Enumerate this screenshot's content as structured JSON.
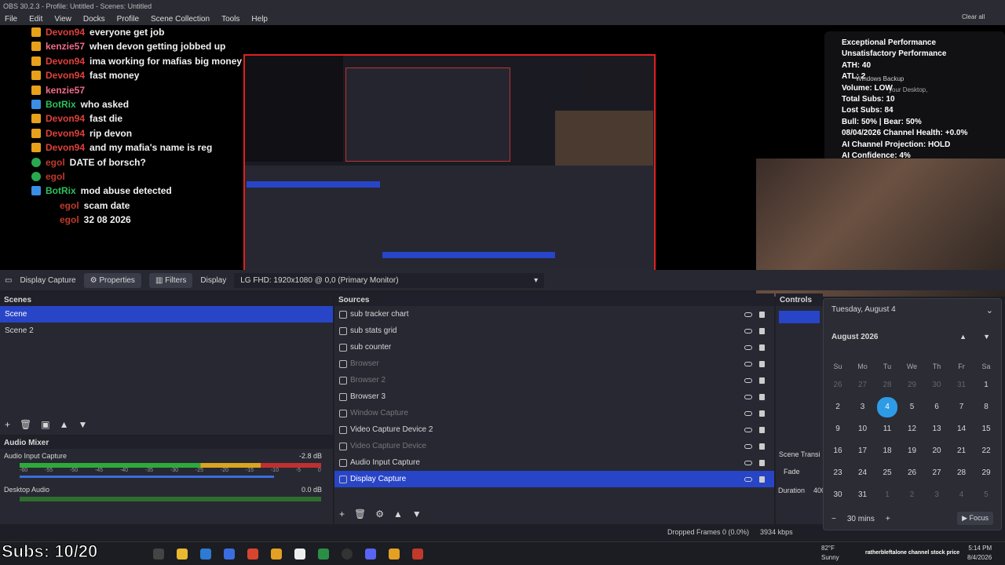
{
  "window": {
    "title": "OBS 30.2.3 - Profile: Untitled - Scenes: Untitled"
  },
  "menu": [
    "File",
    "Edit",
    "View",
    "Docks",
    "Profile",
    "Scene Collection",
    "Tools",
    "Help"
  ],
  "chat": [
    {
      "user": "Devon94",
      "msg": "everyone get job",
      "type": "crown",
      "ucls": "user-devon"
    },
    {
      "user": "kenzie57",
      "msg": "when devon getting jobbed up",
      "type": "crown",
      "ucls": "user-kenzie"
    },
    {
      "user": "Devon94",
      "msg": "ima working for mafias big money",
      "type": "crown",
      "ucls": "user-devon"
    },
    {
      "user": "Devon94",
      "msg": "fast money",
      "type": "crown",
      "ucls": "user-devon"
    },
    {
      "user": "kenzie57",
      "msg": "",
      "type": "crown",
      "ucls": "user-kenzie"
    },
    {
      "user": "BotRix",
      "msg": "who asked",
      "type": "bot",
      "ucls": "user-bot"
    },
    {
      "user": "Devon94",
      "msg": "fast die",
      "type": "crown",
      "ucls": "user-devon"
    },
    {
      "user": "Devon94",
      "msg": "rip devon",
      "type": "crown",
      "ucls": "user-devon"
    },
    {
      "user": "Devon94",
      "msg": "and my mafia's name is reg",
      "type": "crown",
      "ucls": "user-devon"
    },
    {
      "user": "egol",
      "msg": "DATE of borsch?",
      "type": "mod",
      "ucls": "user-egol"
    },
    {
      "user": "egol",
      "msg": "",
      "type": "mod",
      "ucls": "user-egol"
    },
    {
      "user": "BotRix",
      "msg": "mod abuse detected",
      "type": "bot",
      "ucls": "user-bot"
    },
    {
      "user": "egol",
      "msg": "scam date",
      "type": "none",
      "ucls": "user-egol"
    },
    {
      "user": "egol",
      "msg": "32 08 2026",
      "type": "none",
      "ucls": "user-egol"
    }
  ],
  "stats": [
    {
      "text": "Exceptional Performance",
      "color": "#ffffff"
    },
    {
      "text": "Unsatisfactory Performance",
      "color": "#ffffff"
    },
    {
      "text": "ATH: 40",
      "color": "#ffffff"
    },
    {
      "text": "ATL: 2",
      "color": "#ffffff"
    },
    {
      "text": "Volume: LOW",
      "color": "#ffffff"
    },
    {
      "text": "Total Subs: 10",
      "color": "#ffffff"
    },
    {
      "text": "Lost Subs: 84",
      "color": "#ffffff"
    },
    {
      "text": "Bull: 50% | Bear: 50%",
      "color": "#ffffff"
    },
    {
      "text": "08/04/2026 Channel Health: +0.0%",
      "color": "#ffffff"
    },
    {
      "text": "AI Channel Projection: HOLD",
      "color": "#ffffff"
    },
    {
      "text": "AI Confidence: 4%",
      "color": "#ffffff"
    }
  ],
  "notif": {
    "title": "Windows Backup",
    "sub": "your Desktop,",
    "clear": "Clear all"
  },
  "source_toolbar": {
    "name": "Display Capture",
    "properties": "Properties",
    "filters": "Filters",
    "display_label": "Display",
    "display_value": "LG FHD: 1920x1080 @ 0,0 (Primary Monitor)"
  },
  "scenes": {
    "title": "Scenes",
    "items": [
      "Scene",
      "Scene 2"
    ]
  },
  "sources": {
    "title": "Sources",
    "items": [
      {
        "name": "sub tracker chart",
        "dim": false
      },
      {
        "name": "sub stats grid",
        "dim": false
      },
      {
        "name": "sub counter",
        "dim": false
      },
      {
        "name": "Browser",
        "dim": true
      },
      {
        "name": "Browser 2",
        "dim": true
      },
      {
        "name": "Browser 3",
        "dim": false
      },
      {
        "name": "Window Capture",
        "dim": true
      },
      {
        "name": "Video Capture Device 2",
        "dim": false
      },
      {
        "name": "Video Capture Device",
        "dim": true
      },
      {
        "name": "Audio Input Capture",
        "dim": false
      },
      {
        "name": "Display Capture",
        "dim": false
      }
    ]
  },
  "mixer": {
    "title": "Audio Mixer",
    "ch1": "Audio Input Capture",
    "ch1db": "-2.8 dB",
    "ch2": "Desktop Audio",
    "ch2db": "0.0 dB",
    "ticks": [
      "-60",
      "-55",
      "-50",
      "-45",
      "-40",
      "-35",
      "-30",
      "-25",
      "-20",
      "-15",
      "-10",
      "-5",
      "0"
    ]
  },
  "controls": {
    "title": "Controls",
    "transition": "Scene Transi",
    "fade": "Fade",
    "duration": "Duration",
    "dur_val": "400"
  },
  "calendar": {
    "header": "Tuesday, August 4",
    "month": "August 2026",
    "days": [
      "Su",
      "Mo",
      "Tu",
      "We",
      "Th",
      "Fr",
      "Sa"
    ],
    "cells": [
      "26",
      "27",
      "28",
      "29",
      "30",
      "31",
      "1",
      "2",
      "3",
      "4",
      "5",
      "6",
      "7",
      "8",
      "9",
      "10",
      "11",
      "12",
      "13",
      "14",
      "15",
      "16",
      "17",
      "18",
      "19",
      "20",
      "21",
      "22",
      "23",
      "24",
      "25",
      "26",
      "27",
      "28",
      "29",
      "30",
      "31",
      "1",
      "2",
      "3",
      "4",
      "5"
    ],
    "focus_time": "30 mins",
    "focus": "Focus"
  },
  "status": {
    "dropped": "Dropped Frames 0 (0.0%)",
    "kbps": "3934 kbps"
  },
  "overlay_subs": "Subs: 10/20",
  "weather": {
    "temp": "82°F",
    "cond": "Sunny"
  },
  "clock": {
    "time": "5:14 PM",
    "date": "8/4/2026"
  },
  "tray_text": "ratherbleftalone channel stock price"
}
